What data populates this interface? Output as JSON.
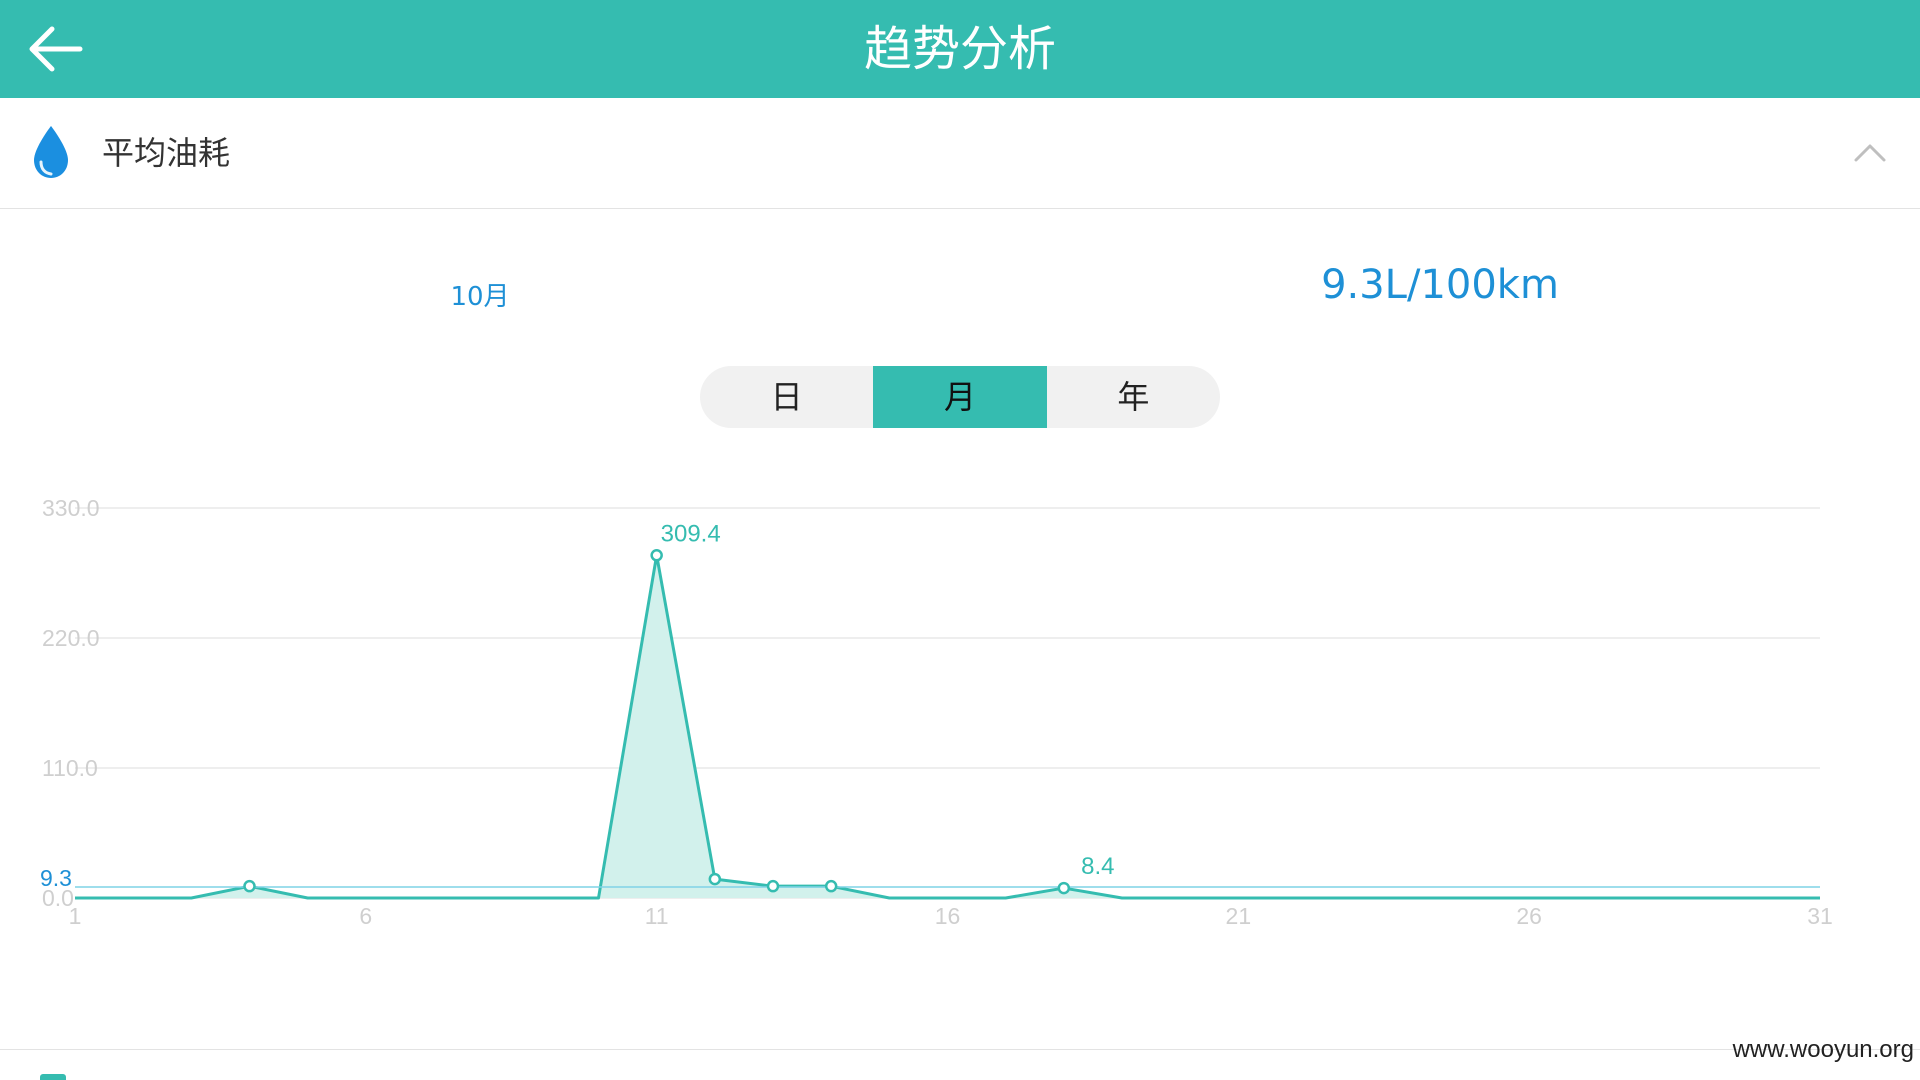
{
  "header": {
    "title": "趋势分析",
    "back_icon": "arrow-left-icon"
  },
  "section": {
    "title": "平均油耗",
    "icon": "water-drop-icon",
    "collapse_icon": "chevron-up-icon"
  },
  "summary": {
    "period": "10月",
    "average": "9.3L/100km"
  },
  "segments": [
    {
      "label": "日",
      "active": false
    },
    {
      "label": "月",
      "active": true
    },
    {
      "label": "年",
      "active": false
    }
  ],
  "colors": {
    "accent": "#35bcb0",
    "value_blue": "#1e90d6",
    "fill": "#d2f1ec",
    "avg_line": "#7fd3e6"
  },
  "chart_data": {
    "type": "area",
    "x": [
      1,
      2,
      3,
      4,
      5,
      6,
      7,
      8,
      9,
      10,
      11,
      12,
      13,
      14,
      15,
      16,
      17,
      18,
      19,
      20,
      21,
      22,
      23,
      24,
      25,
      26,
      27,
      28,
      29,
      30,
      31
    ],
    "values": [
      0,
      0,
      0,
      10,
      0,
      0,
      0,
      0,
      0,
      0,
      290,
      16,
      10,
      10,
      0,
      0,
      0,
      8.4,
      0,
      0,
      0,
      0,
      0,
      0,
      0,
      0,
      0,
      0,
      0,
      0,
      0
    ],
    "markers": [
      4,
      11,
      12,
      13,
      14,
      18
    ],
    "labeled_points": [
      {
        "x": 11,
        "label": "309.4"
      },
      {
        "x": 18,
        "label": "8.4"
      }
    ],
    "y_ticks": [
      "330.0",
      "220.0",
      "110.0",
      "0.0"
    ],
    "y_tick_values": [
      330,
      220,
      110,
      0
    ],
    "x_ticks": [
      1,
      6,
      11,
      16,
      21,
      26,
      31
    ],
    "ylim": [
      0,
      330
    ],
    "xlim": [
      1,
      31
    ],
    "average_line": {
      "value": 9.3,
      "label": "9.3"
    },
    "grid": true
  }
}
